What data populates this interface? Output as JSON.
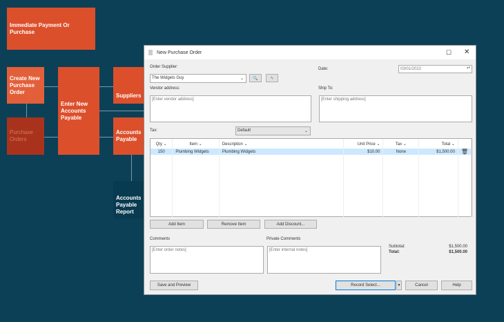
{
  "flow": {
    "immediate": "Immediate Payment Or Purchase",
    "create_po": "Create New Purchase Order",
    "purchase_orders": "Purchase Orders",
    "enter_ap": "Enter New Accounts Payable",
    "suppliers": "Suppliers",
    "accounts_payable": "Accounts Payable",
    "ap_report": "Accounts Payable Report"
  },
  "dialog": {
    "title": "New Purchase Order",
    "order_supplier_label": "Order Supplier:",
    "supplier": "The Widgets Guy",
    "date_label": "Date:",
    "date": "03/01/2022",
    "vendor_label": "Vendor address:",
    "vendor_placeholder": "[Enter vendor address]",
    "ship_label": "Ship To:",
    "ship_placeholder": "[Enter shipping address]",
    "tax_label": "Tax:",
    "tax": "Default",
    "columns": [
      "Qty",
      "Item",
      "Description",
      "Unit Price",
      "Tax",
      "Total"
    ],
    "rows": [
      {
        "qty": "150",
        "item": "Plumbing Widgets",
        "description": "Plumbing Widgets",
        "unit_price": "$10.00",
        "tax": "None",
        "total": "$1,500.00"
      }
    ],
    "add_item": "Add Item",
    "remove_item": "Remove Item",
    "add_discount": "Add Discount...",
    "comments_label": "Comments",
    "comments_placeholder": "[Enter order notes]",
    "private_label": "Private Comments",
    "private_placeholder": "[Enter internal notes]",
    "subtotal_label": "Subtotal:",
    "subtotal": "$1,500.00",
    "total_label": "Total:",
    "total": "$1,500.00",
    "save_preview": "Save and Preview",
    "record": "Record Select...",
    "cancel": "Cancel",
    "help": "Help"
  }
}
